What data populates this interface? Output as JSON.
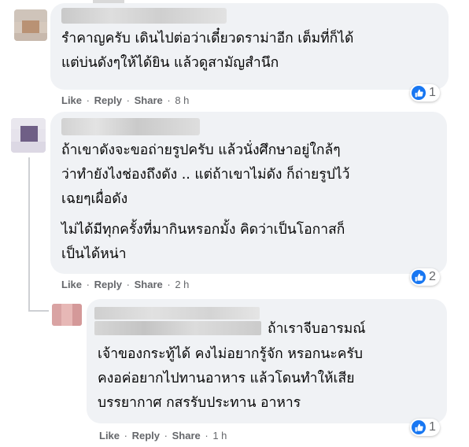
{
  "comments": [
    {
      "text": "รำคาญครับ เดินไปต่อว่าเดี๋ยวดราม่าอีก เต็มที่ก็ได้\nแต่บ่นดังๆให้ได้ยิน แล้วดูสามัญสำนึก",
      "actions": {
        "like": "Like",
        "reply": "Reply",
        "share": "Share",
        "dot": "·",
        "time": "8 h"
      },
      "reaction_count": "1"
    },
    {
      "paragraphs": [
        "ถ้าเขาดังจะขอถ่ายรูปครับ แล้วนั่งศึกษาอยู่ใกล้ๆ\nว่าทำยังไงช่องถึงดัง .. แต่ถ้าเขาไม่ดัง ก็ถ่ายรูปไว้\nเฉยๆเผื่อดัง",
        "ไม่ได้มีทุกครั้งที่มากินหรอกมั้ง คิดว่าเป็นโอกาสก็\nเป็นได้หน่า"
      ],
      "actions": {
        "like": "Like",
        "reply": "Reply",
        "share": "Share",
        "dot": "·",
        "time": "2 h"
      },
      "reaction_count": "2"
    },
    {
      "inline_text": "ถ้าเราจีบอารมณ์",
      "text": "เจ้าของกระทู้ได้ คงไม่อยากรู้จัก หรอกนะครับ\nคงอค่อยากไปทานอาหาร แล้วโดนทำให้เสีย\nบรรยากาศ กสรรับประทาน อาหาร",
      "actions": {
        "like": "Like",
        "reply": "Reply",
        "share": "Share",
        "dot": "·",
        "time": "1 h"
      },
      "reaction_count": "1"
    }
  ],
  "colors": {
    "bubble": "#f0f2f5",
    "meta": "#65676b",
    "like_blue": "#1877f2"
  },
  "icons": {
    "reaction": "thumbs-up-like-icon"
  }
}
